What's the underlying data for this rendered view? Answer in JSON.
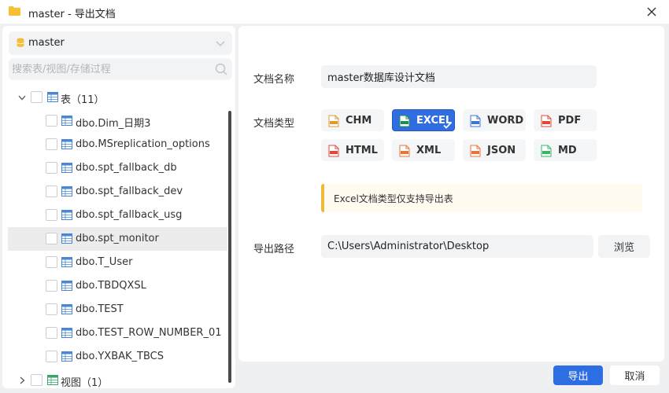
{
  "window": {
    "title": "master - 导出文档"
  },
  "sidebar": {
    "database": "master",
    "search_placeholder": "搜索表/视图/存储过程",
    "tables_group": {
      "label": "表（11）"
    },
    "tables": [
      "dbo.Dim_日期3",
      "dbo.MSreplication_options",
      "dbo.spt_fallback_db",
      "dbo.spt_fallback_dev",
      "dbo.spt_fallback_usg",
      "dbo.spt_monitor",
      "dbo.T_User",
      "dbo.TBDQXSL",
      "dbo.TEST",
      "dbo.TEST_ROW_NUMBER_01",
      "dbo.YXBAK_TBCS"
    ],
    "selected_table": "dbo.spt_monitor",
    "views_group": {
      "label": "视图（1）"
    }
  },
  "form": {
    "name_label": "文档名称",
    "name_value": "master数据库设计文档",
    "type_label": "文档类型",
    "types": [
      {
        "label": "CHM",
        "icon": "chm-file-icon",
        "color": "#e09a2f"
      },
      {
        "label": "EXCEL",
        "icon": "excel-file-icon",
        "color": "#1d8f4c",
        "selected": true
      },
      {
        "label": "WORD",
        "icon": "word-file-icon",
        "color": "#3b76d6"
      },
      {
        "label": "PDF",
        "icon": "pdf-file-icon",
        "color": "#e0483c"
      },
      {
        "label": "HTML",
        "icon": "html-file-icon",
        "color": "#e0483c"
      },
      {
        "label": "XML",
        "icon": "xml-file-icon",
        "color": "#e8743a"
      },
      {
        "label": "JSON",
        "icon": "json-file-icon",
        "color": "#e8743a"
      },
      {
        "label": "MD",
        "icon": "md-file-icon",
        "color": "#3bb36a"
      }
    ],
    "notice": "Excel文档类型仅支持导出表",
    "path_label": "导出路径",
    "path_value": "C:\\Users\\Administrator\\Desktop",
    "browse_label": "浏览"
  },
  "footer": {
    "export_label": "导出",
    "cancel_label": "取消"
  },
  "colors": {
    "accent": "#2d6fe3",
    "notice_bar": "#f0b93a",
    "folder": "#f5c033"
  }
}
